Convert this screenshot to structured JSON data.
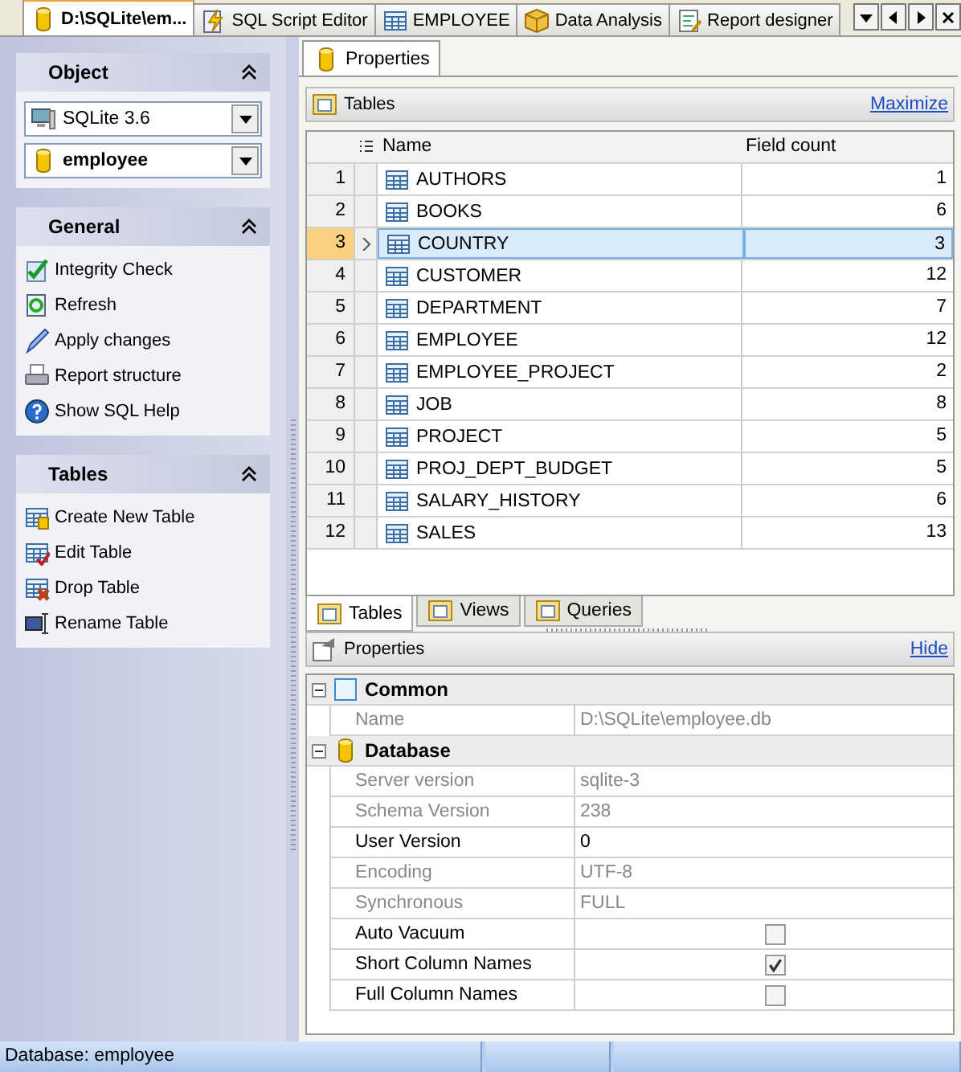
{
  "doc_tabs": [
    {
      "label": "D:\\SQLite\\em...",
      "selected": true
    },
    {
      "label": "SQL Script Editor",
      "selected": false
    },
    {
      "label": "EMPLOYEE",
      "selected": false
    },
    {
      "label": "Data Analysis",
      "selected": false
    },
    {
      "label": "Report designer",
      "selected": false
    }
  ],
  "sidebar": {
    "sections": [
      {
        "title": "Object",
        "expanded": true,
        "kind": "selects",
        "selects": [
          {
            "value": "SQLite 3.6"
          },
          {
            "value": "employee"
          }
        ]
      },
      {
        "title": "General",
        "expanded": true,
        "kind": "links",
        "items": [
          {
            "label": "Integrity Check"
          },
          {
            "label": "Refresh"
          },
          {
            "label": "Apply changes"
          },
          {
            "label": "Report structure"
          },
          {
            "label": "Show SQL Help"
          }
        ]
      },
      {
        "title": "Tables",
        "expanded": true,
        "kind": "links",
        "items": [
          {
            "label": "Create New Table"
          },
          {
            "label": "Edit Table"
          },
          {
            "label": "Drop Table"
          },
          {
            "label": "Rename Table"
          }
        ]
      }
    ]
  },
  "content_tab": {
    "label": "Properties"
  },
  "tables_panel": {
    "title": "Tables",
    "action": "Maximize",
    "columns": [
      "Name",
      "Field count"
    ],
    "rows": [
      {
        "index": "1",
        "name": "AUTHORS",
        "count": "1",
        "selected": false
      },
      {
        "index": "2",
        "name": "BOOKS",
        "count": "6",
        "selected": false
      },
      {
        "index": "3",
        "name": "COUNTRY",
        "count": "3",
        "selected": true
      },
      {
        "index": "4",
        "name": "CUSTOMER",
        "count": "12",
        "selected": false
      },
      {
        "index": "5",
        "name": "DEPARTMENT",
        "count": "7",
        "selected": false
      },
      {
        "index": "6",
        "name": "EMPLOYEE",
        "count": "12",
        "selected": false
      },
      {
        "index": "7",
        "name": "EMPLOYEE_PROJECT",
        "count": "2",
        "selected": false
      },
      {
        "index": "8",
        "name": "JOB",
        "count": "8",
        "selected": false
      },
      {
        "index": "9",
        "name": "PROJECT",
        "count": "5",
        "selected": false
      },
      {
        "index": "10",
        "name": "PROJ_DEPT_BUDGET",
        "count": "5",
        "selected": false
      },
      {
        "index": "11",
        "name": "SALARY_HISTORY",
        "count": "6",
        "selected": false
      },
      {
        "index": "12",
        "name": "SALES",
        "count": "13",
        "selected": false
      }
    ],
    "tabs": [
      {
        "label": "Tables",
        "selected": true
      },
      {
        "label": "Views",
        "selected": false
      },
      {
        "label": "Queries",
        "selected": false
      }
    ]
  },
  "properties_panel": {
    "title": "Properties",
    "action": "Hide",
    "groups": [
      {
        "title": "Common",
        "expanded": true,
        "rows": [
          {
            "kind": "text",
            "name": "Name",
            "value": "D:\\SQLite\\employee.db",
            "disabled": true
          }
        ]
      },
      {
        "title": "Database",
        "expanded": true,
        "rows": [
          {
            "kind": "text",
            "name": "Server version",
            "value": "sqlite-3",
            "disabled": true
          },
          {
            "kind": "text",
            "name": "Schema Version",
            "value": "238",
            "disabled": true
          },
          {
            "kind": "text",
            "name": "User Version",
            "value": "0",
            "disabled": false
          },
          {
            "kind": "text",
            "name": "Encoding",
            "value": "UTF-8",
            "disabled": true
          },
          {
            "kind": "text",
            "name": "Synchronous",
            "value": "FULL",
            "disabled": true
          },
          {
            "kind": "check",
            "name": "Auto Vacuum",
            "checked": false
          },
          {
            "kind": "check",
            "name": "Short Column Names",
            "checked": true
          },
          {
            "kind": "check",
            "name": "Full Column Names",
            "checked": false
          }
        ]
      }
    ]
  },
  "status_bar": [
    "Database: employee"
  ]
}
